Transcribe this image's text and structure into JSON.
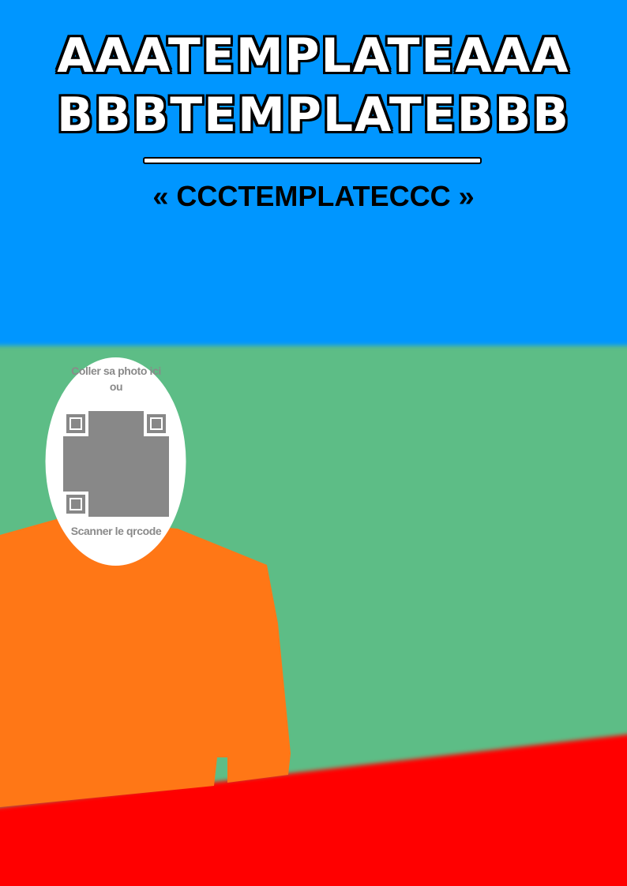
{
  "title": {
    "line1": "AAATEMPLATEAAA",
    "line2": "BBBTEMPLATEBBB"
  },
  "subtitle": "« CCCTEMPLATECCC »",
  "photo_placeholder": {
    "top_text": "Coller sa photo ici ou",
    "bottom_text": "Scanner le qrcode"
  },
  "colors": {
    "sky": "#0096ff",
    "grass": "#5dbd86",
    "ground": "#ff0000",
    "figure": "#ff7716",
    "qr": "#888888",
    "oval": "#ffffff"
  },
  "icons": [
    "qr-code-icon"
  ]
}
